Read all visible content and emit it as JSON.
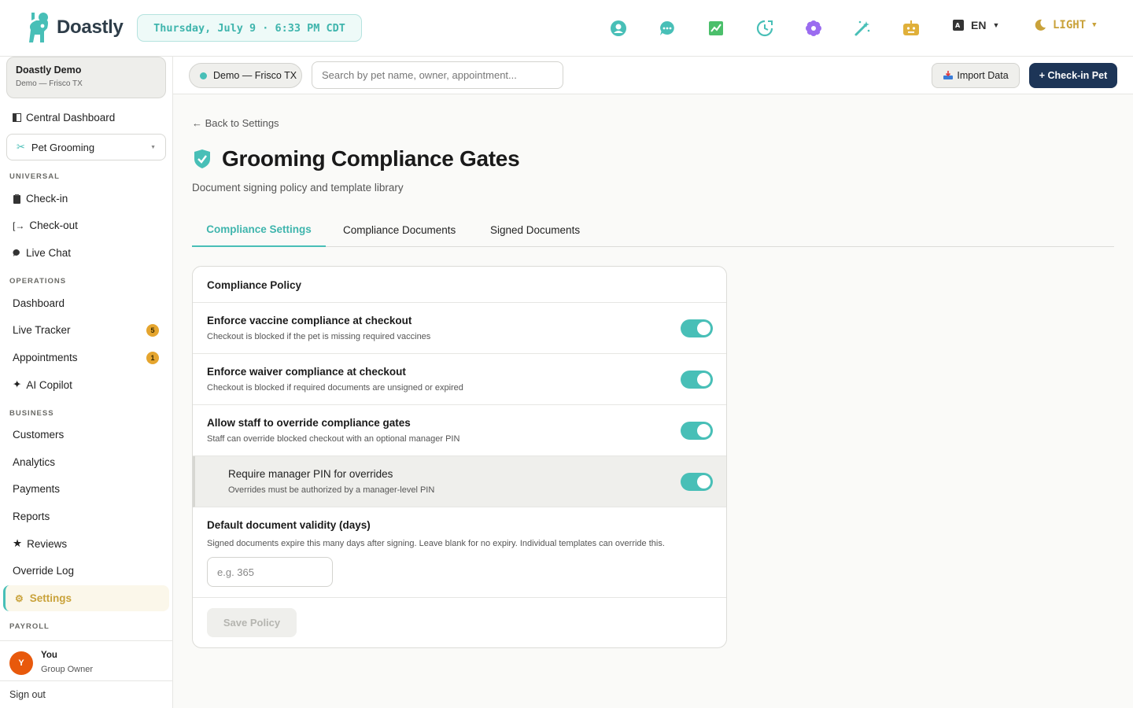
{
  "app": {
    "name": "Doastly"
  },
  "header": {
    "datetime": "Thursday, July 9 · 6:33 PM CDT",
    "language": "EN",
    "theme": "LIGHT"
  },
  "sidebar": {
    "org_name": "Doastly Demo",
    "org_location": "Demo — Frisco TX",
    "central_dashboard": "Central Dashboard",
    "module": "Pet Grooming",
    "sections": {
      "universal": "UNIVERSAL",
      "operations": "OPERATIONS",
      "business": "BUSINESS",
      "payroll": "PAYROLL"
    },
    "universal_items": [
      "Check-in",
      "Check-out",
      "Live Chat"
    ],
    "operations_items": [
      "Dashboard",
      "Live Tracker",
      "Appointments",
      "AI Copilot"
    ],
    "live_tracker_badge": "5",
    "appointments_badge": "1",
    "business_items": [
      "Customers",
      "Analytics",
      "Payments",
      "Reports",
      "Reviews",
      "Override Log",
      "Settings"
    ],
    "user": {
      "initial": "Y",
      "name": "You",
      "role": "Group Owner"
    },
    "sign_out": "Sign out"
  },
  "subbar": {
    "location": "Demo — Frisco TX",
    "search_placeholder": "Search by pet name, owner, appointment...",
    "import_label": "Import Data",
    "checkin_label": "+ Check-in Pet"
  },
  "page": {
    "back": "← Back to Settings",
    "title": "Grooming Compliance Gates",
    "subtitle": "Document signing policy and template library",
    "tabs": [
      "Compliance Settings",
      "Compliance Documents",
      "Signed Documents"
    ],
    "card_title": "Compliance Policy",
    "rows": [
      {
        "label": "Enforce vaccine compliance at checkout",
        "desc": "Checkout is blocked if the pet is missing required vaccines"
      },
      {
        "label": "Enforce waiver compliance at checkout",
        "desc": "Checkout is blocked if required documents are unsigned or expired"
      },
      {
        "label": "Allow staff to override compliance gates",
        "desc": "Staff can override blocked checkout with an optional manager PIN"
      },
      {
        "label": "Require manager PIN for overrides",
        "desc": "Overrides must be authorized by a manager-level PIN"
      }
    ],
    "validity_label": "Default document validity (days)",
    "validity_desc": "Signed documents expire this many days after signing. Leave blank for no expiry. Individual templates can override this.",
    "validity_placeholder": "e.g. 365",
    "save_label": "Save Policy"
  },
  "colors": {
    "accent": "#48bfb7",
    "navy": "#1d3557",
    "gold": "#c9a23a",
    "badge": "#e5a52e"
  }
}
